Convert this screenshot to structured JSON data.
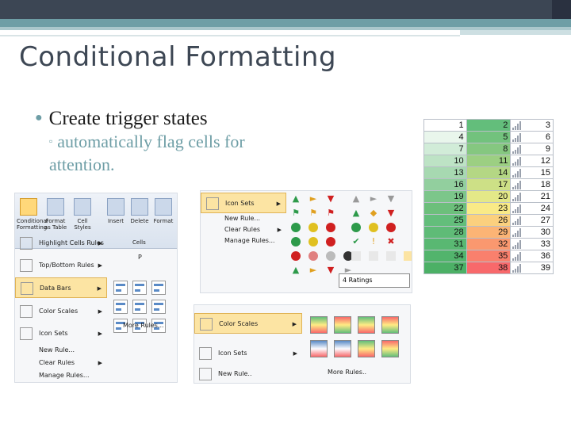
{
  "slide": {
    "title": "Conditional Formatting",
    "bullet": "Create trigger states",
    "sub_bullet": "automatically flag cells for attention."
  },
  "grid": {
    "rows": [
      [
        "1",
        "2",
        "3"
      ],
      [
        "4",
        "5",
        "6"
      ],
      [
        "7",
        "8",
        "9"
      ],
      [
        "10",
        "11",
        "12"
      ],
      [
        "13",
        "14",
        "15"
      ],
      [
        "16",
        "17",
        "18"
      ],
      [
        "19",
        "20",
        "21"
      ],
      [
        "22",
        "23",
        "24"
      ],
      [
        "25",
        "26",
        "27"
      ],
      [
        "28",
        "29",
        "30"
      ],
      [
        "31",
        "32",
        "33"
      ],
      [
        "34",
        "35",
        "36"
      ],
      [
        "37",
        "38",
        "39"
      ]
    ],
    "col1_colors": [
      "#ffffff",
      "#e9f6ec",
      "#d1ecd8",
      "#bde3c5",
      "#a7d9b1",
      "#92cf9e",
      "#7cc68a",
      "#6cbf7b",
      "#63be7b",
      "#5fbb77",
      "#59b872",
      "#52b46c",
      "#4cb066"
    ],
    "col2_colors": [
      "#63be7b",
      "#72c27d",
      "#85c780",
      "#9ccf82",
      "#b4d784",
      "#cde086",
      "#e4e888",
      "#f9ea87",
      "#fbd07e",
      "#fcb475",
      "#fa986f",
      "#f9806d",
      "#f8696b"
    ]
  },
  "ribbon": {
    "conditional_formatting": "Conditional Formatting",
    "format_table": "Format as Table",
    "cell_styles": "Cell Styles",
    "insert": "Insert",
    "delete": "Delete",
    "format": "Format",
    "cells": "Cells"
  },
  "cf_menu": {
    "highlight": "Highlight Cells Rules",
    "topbottom": "Top/Bottom Rules",
    "databars": "Data Bars",
    "colorscales": "Color Scales",
    "iconsets": "Icon Sets",
    "newrule": "New Rule...",
    "clearrules": "Clear Rules",
    "managerules": "Manage Rules...",
    "more_rules": "More Rules..."
  },
  "icon_menu": {
    "iconsets": "Icon Sets",
    "newrule": "New Rule...",
    "clearrules": "Clear Rules",
    "managerules": "Manage Rules...",
    "tooltip": "4 Ratings"
  },
  "cs_menu": {
    "colorscales": "Color Scales",
    "iconsets": "Icon Sets",
    "newrule": "New Rule..",
    "more_rules": "More Rules.."
  },
  "sheet_cols": [
    "P"
  ]
}
